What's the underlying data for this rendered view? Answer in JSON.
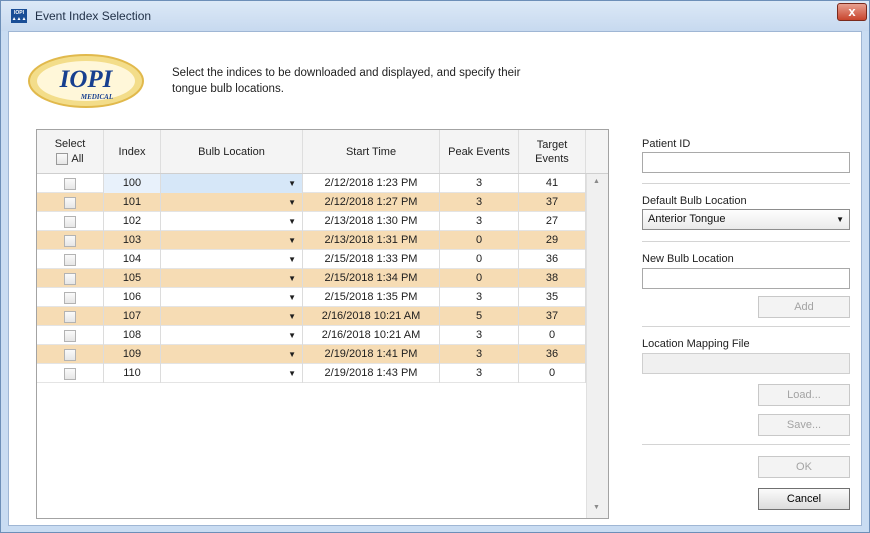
{
  "window": {
    "title": "Event Index Selection",
    "close_label": "x",
    "app_icon_text": [
      "IOPI",
      "▲▲▲"
    ]
  },
  "header": {
    "logo_text": "IOPI",
    "logo_subtext": "MEDICAL",
    "instruction_line1": "Select the indices to be downloaded and displayed, and specify their",
    "instruction_line2": "tongue bulb locations."
  },
  "table": {
    "columns": {
      "select": "Select",
      "select_all": "All",
      "index": "Index",
      "bulb_location": "Bulb Location",
      "start_time": "Start Time",
      "peak_events": "Peak Events",
      "target_events_1": "Target",
      "target_events_2": "Events"
    },
    "rows": [
      {
        "index": "100",
        "start": "2/12/2018 1:23 PM",
        "peak": "3",
        "target": "41"
      },
      {
        "index": "101",
        "start": "2/12/2018 1:27 PM",
        "peak": "3",
        "target": "37"
      },
      {
        "index": "102",
        "start": "2/13/2018 1:30 PM",
        "peak": "3",
        "target": "27"
      },
      {
        "index": "103",
        "start": "2/13/2018 1:31 PM",
        "peak": "0",
        "target": "29"
      },
      {
        "index": "104",
        "start": "2/15/2018 1:33 PM",
        "peak": "0",
        "target": "36"
      },
      {
        "index": "105",
        "start": "2/15/2018 1:34 PM",
        "peak": "0",
        "target": "38"
      },
      {
        "index": "106",
        "start": "2/15/2018 1:35 PM",
        "peak": "3",
        "target": "35"
      },
      {
        "index": "107",
        "start": "2/16/2018 10:21 AM",
        "peak": "5",
        "target": "37"
      },
      {
        "index": "108",
        "start": "2/16/2018 10:21 AM",
        "peak": "3",
        "target": "0"
      },
      {
        "index": "109",
        "start": "2/19/2018 1:41 PM",
        "peak": "3",
        "target": "36"
      },
      {
        "index": "110",
        "start": "2/19/2018 1:43 PM",
        "peak": "3",
        "target": "0"
      }
    ]
  },
  "panel": {
    "patient_id_label": "Patient ID",
    "patient_id_value": "",
    "default_bulb_label": "Default Bulb Location",
    "default_bulb_value": "Anterior Tongue",
    "new_bulb_label": "New Bulb Location",
    "new_bulb_value": "",
    "add_label": "Add",
    "mapping_file_label": "Location Mapping File",
    "mapping_file_value": "",
    "load_label": "Load...",
    "save_label": "Save...",
    "ok_label": "OK",
    "cancel_label": "Cancel"
  },
  "colors": {
    "alt_row": "#f6dcb4",
    "selected_row": "#d6e7f8",
    "window_frame": "#c9dcf2",
    "close_button": "#c8452d"
  }
}
